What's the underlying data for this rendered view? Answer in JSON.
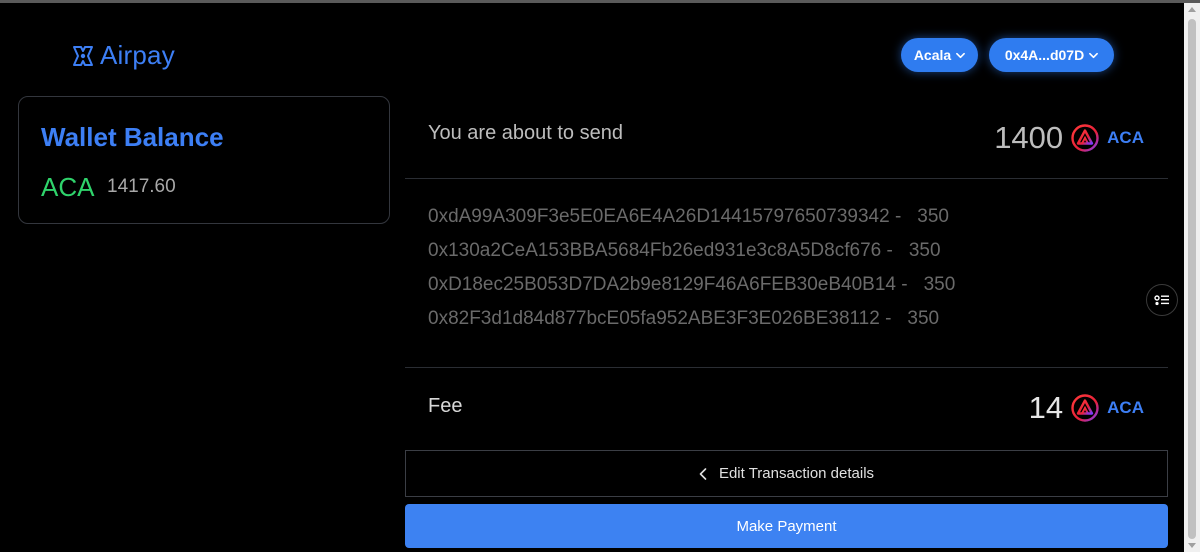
{
  "brand": {
    "name": "Airpay",
    "color": "#3d7ff5"
  },
  "header": {
    "network_label": "Acala",
    "account_label": "0x4A...d07D",
    "pill_color": "#2f7cf0"
  },
  "wallet": {
    "title": "Wallet Balance",
    "token": "ACA",
    "amount": "1417.60",
    "token_color": "#2fd36b"
  },
  "send": {
    "label": "You are about to send",
    "amount": "1400",
    "token": "ACA",
    "token_icon": "acala-token-icon"
  },
  "recipients": [
    {
      "address": "0xdA99A309F3e5E0EA6E4A26D14415797650739342 -",
      "amount": "350"
    },
    {
      "address": "0x130a2CeA153BBA5684Fb26ed931e3c8A5D8cf676 -",
      "amount": "350"
    },
    {
      "address": "0xD18ec25B053D7DA2b9e8129F46A6FEB30eB40B14 -",
      "amount": "350"
    },
    {
      "address": "0x82F3d1d84d877bcE05fa952ABE3F3E026BE38112 -",
      "amount": "350"
    }
  ],
  "fee": {
    "label": "Fee",
    "amount": "14",
    "token": "ACA"
  },
  "actions": {
    "edit_label": "Edit Transaction details",
    "pay_label": "Make Payment",
    "pay_color": "#3d82f2"
  }
}
